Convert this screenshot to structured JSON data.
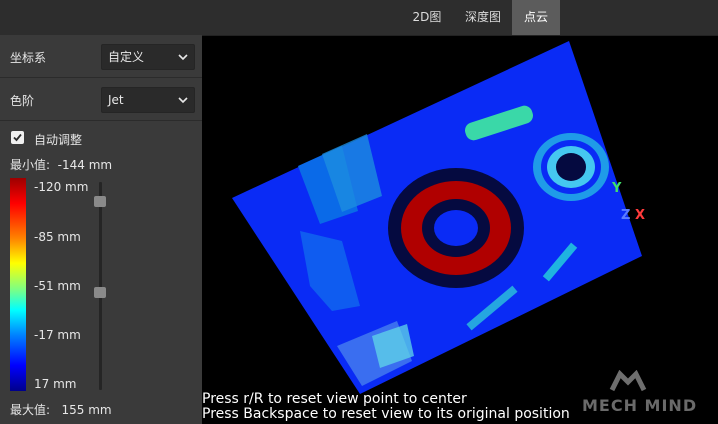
{
  "tabs": [
    {
      "label": "2D图"
    },
    {
      "label": "深度图"
    },
    {
      "label": "点云"
    }
  ],
  "panel": {
    "coord_label": "坐标系",
    "coord_value": "自定义",
    "colormap_label": "色阶",
    "colormap_value": "Jet",
    "auto_adjust_label": "自动调整",
    "auto_adjust_checked": true,
    "min_text": "最小值:  -144 mm",
    "max_text": "最大值:   155 mm",
    "ticks": [
      "-120 mm",
      "-85 mm",
      "-51 mm",
      "-17 mm",
      "17 mm"
    ]
  },
  "viewport": {
    "hint_lines": [
      "Press r/R to reset view point to center",
      "Press Backspace to reset view to its original position"
    ],
    "axes": {
      "y": "Y",
      "z": "Z",
      "x": "X"
    },
    "watermark": "MECH MIND"
  }
}
